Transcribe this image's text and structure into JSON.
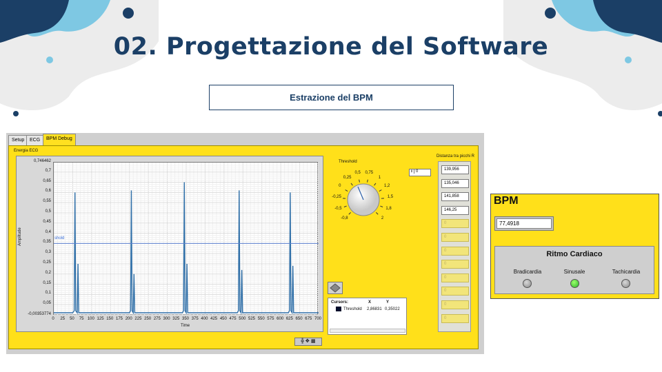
{
  "slide": {
    "title": "02. Progettazione del Software",
    "subtitle": "Estrazione del BPM",
    "colors": {
      "title": "#1b3f66",
      "accent_dark": "#1b3f66",
      "accent_light": "#7ec8e3",
      "panel_yellow": "#ffe01a"
    }
  },
  "labview": {
    "tabs": [
      "Setup",
      "ECG",
      "BPM Debug"
    ],
    "active_tab": "BPM Debug",
    "chart": {
      "label": "Energia ECG",
      "ylabel": "Amplitude",
      "xlabel": "Time",
      "threshold_label": "shold",
      "y_ticks": [
        "0,746462",
        "0,7",
        "0,65",
        "0,6",
        "0,55",
        "0,5",
        "0,45",
        "0,4",
        "0,35",
        "0,3",
        "0,25",
        "0,2",
        "0,15",
        "0,1",
        "0,05",
        "-0,00353774"
      ],
      "x_ticks": [
        "0",
        "25",
        "50",
        "75",
        "100",
        "125",
        "150",
        "175",
        "200",
        "225",
        "250",
        "275",
        "300",
        "325",
        "350",
        "375",
        "400",
        "425",
        "450",
        "475",
        "500",
        "525",
        "550",
        "575",
        "600",
        "625",
        "650",
        "675",
        "700"
      ]
    },
    "chart_data": {
      "type": "line",
      "title": "Energia ECG",
      "xlabel": "Time",
      "ylabel": "Amplitude",
      "xlim": [
        0,
        700
      ],
      "ylim": [
        -0.00353774,
        0.746462
      ],
      "series": [
        {
          "name": "",
          "x": [
            0,
            50,
            54,
            56,
            58,
            62,
            64,
            66,
            70,
            200,
            203,
            205,
            207,
            210,
            212,
            214,
            220,
            340,
            343,
            345,
            347,
            350,
            352,
            354,
            360,
            485,
            488,
            490,
            492,
            495,
            497,
            499,
            505,
            620,
            623,
            625,
            627,
            630,
            632,
            634,
            640,
            700
          ],
          "y": [
            0.01,
            0.01,
            0.02,
            0.6,
            0.02,
            0.01,
            0.25,
            0.01,
            0.01,
            0.01,
            0.02,
            0.61,
            0.02,
            0.01,
            0.2,
            0.01,
            0.01,
            0.01,
            0.02,
            0.65,
            0.02,
            0.01,
            0.25,
            0.01,
            0.01,
            0.01,
            0.02,
            0.61,
            0.02,
            0.01,
            0.22,
            0.01,
            0.01,
            0.01,
            0.02,
            0.6,
            0.02,
            0.01,
            0.24,
            0.01,
            0.01,
            0.01
          ]
        },
        {
          "name": "Threshold",
          "x": [
            0,
            700
          ],
          "y": [
            0.35,
            0.35
          ]
        }
      ]
    },
    "knob": {
      "label": "Threshold",
      "ticks": [
        "-0,8",
        "-0,5",
        "-0,25",
        "0",
        "0,25",
        "0,5",
        "0,75",
        "1",
        "1,2",
        "1,5",
        "1,8",
        "2"
      ],
      "value": 0.35
    },
    "num_control": "0",
    "cursors": {
      "headers": [
        "Cursors:",
        "X",
        "Y"
      ],
      "row": {
        "name": "Threshold",
        "x": "2,86831",
        "y": "0,35022"
      }
    },
    "distanze": {
      "label": "Distanza tra picchi R",
      "values": [
        "139,956",
        "135,046",
        "141,858",
        "146,25",
        "0",
        "0",
        "0",
        "0",
        "0",
        "0",
        "0",
        "0"
      ]
    },
    "graph_tools": "╬ ✥ ▦"
  },
  "bpm_panel": {
    "title": "BPM",
    "value": "77,4918",
    "ritmo_title": "Ritmo Cardiaco",
    "leds": [
      {
        "label": "Bradicardia",
        "state": "off"
      },
      {
        "label": "Sinusale",
        "state": "on"
      },
      {
        "label": "Tachicardia",
        "state": "off"
      }
    ]
  }
}
